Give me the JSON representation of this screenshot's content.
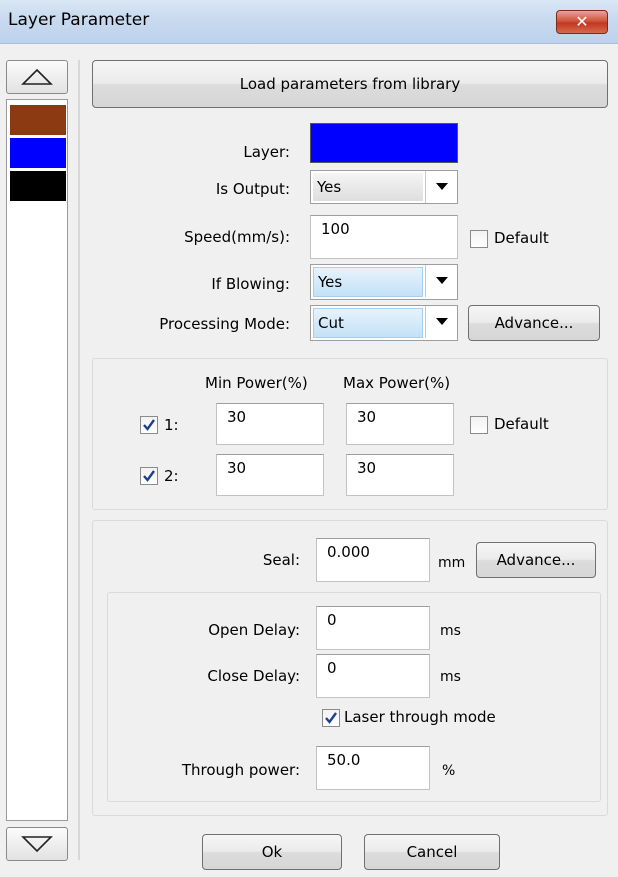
{
  "window": {
    "title": "Layer Parameter",
    "close_glyph": "✕"
  },
  "layer_list": {
    "scroll_up_icon": "triangle-up-icon",
    "scroll_down_icon": "triangle-down-icon",
    "swatches": [
      "#8B3A12",
      "#0000FF",
      "#000000"
    ]
  },
  "load_button": "Load parameters from library",
  "form": {
    "layer_label": "Layer:",
    "layer_color": "#0000FF",
    "is_output_label": "Is Output:",
    "is_output_value": "Yes",
    "speed_label": "Speed(mm/s):",
    "speed_value": "100",
    "speed_default_label": "Default",
    "if_blowing_label": "If Blowing:",
    "if_blowing_value": "Yes",
    "processing_mode_label": "Processing Mode:",
    "processing_mode_value": "Cut",
    "advance_label": "Advance..."
  },
  "power": {
    "min_header": "Min Power(%)",
    "max_header": "Max Power(%)",
    "rows": [
      {
        "label": "1:",
        "checked": true,
        "min": "30",
        "max": "30"
      },
      {
        "label": "2:",
        "checked": true,
        "min": "30",
        "max": "30"
      }
    ],
    "default_label": "Default"
  },
  "seal": {
    "label": "Seal:",
    "value": "0.000",
    "unit": "mm",
    "advance_label": "Advance..."
  },
  "delay": {
    "open_label": "Open Delay:",
    "open_value": "0",
    "open_unit": "ms",
    "close_label": "Close Delay:",
    "close_value": "0",
    "close_unit": "ms",
    "laser_through_label": "Laser through mode",
    "laser_through_checked": true,
    "through_power_label": "Through power:",
    "through_power_value": "50.0",
    "through_power_unit": "%"
  },
  "footer": {
    "ok_label": "Ok",
    "cancel_label": "Cancel"
  }
}
